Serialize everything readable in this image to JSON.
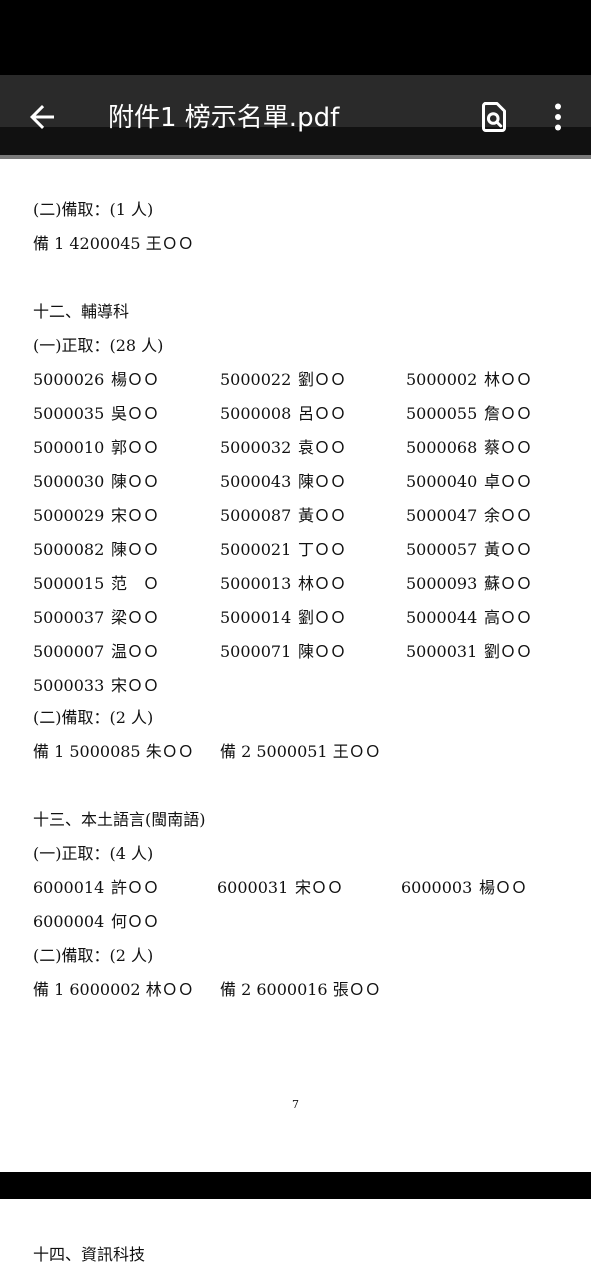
{
  "app_bar": {
    "title": "附件1 榜示名單.pdf",
    "icons": [
      "arrow-back-icon",
      "search-in-document-icon",
      "more-vert-icon"
    ]
  },
  "sec11": {
    "backup_heading": "(二)備取：(1 人)",
    "backup_line": "備 1 4200045 王ＯＯ"
  },
  "sec12": {
    "heading": "十二、輔導科",
    "admit_heading": "(一)正取：(28 人)",
    "rows": [
      [
        {
          "id": "5000026",
          "name": "楊ＯＯ"
        },
        {
          "id": "5000022",
          "name": "劉ＯＯ"
        },
        {
          "id": "5000002",
          "name": "林ＯＯ"
        }
      ],
      [
        {
          "id": "5000035",
          "name": "吳ＯＯ"
        },
        {
          "id": "5000008",
          "name": "呂ＯＯ"
        },
        {
          "id": "5000055",
          "name": "詹ＯＯ"
        }
      ],
      [
        {
          "id": "5000010",
          "name": "郭ＯＯ"
        },
        {
          "id": "5000032",
          "name": "袁ＯＯ"
        },
        {
          "id": "5000068",
          "name": "蔡ＯＯ"
        }
      ],
      [
        {
          "id": "5000030",
          "name": "陳ＯＯ"
        },
        {
          "id": "5000043",
          "name": "陳ＯＯ"
        },
        {
          "id": "5000040",
          "name": "卓ＯＯ"
        }
      ],
      [
        {
          "id": "5000029",
          "name": "宋ＯＯ"
        },
        {
          "id": "5000087",
          "name": "黃ＯＯ"
        },
        {
          "id": "5000047",
          "name": "余ＯＯ"
        }
      ],
      [
        {
          "id": "5000082",
          "name": "陳ＯＯ"
        },
        {
          "id": "5000021",
          "name": "丁ＯＯ"
        },
        {
          "id": "5000057",
          "name": "黃ＯＯ"
        }
      ],
      [
        {
          "id": "5000015",
          "name": "范　Ｏ"
        },
        {
          "id": "5000013",
          "name": "林ＯＯ"
        },
        {
          "id": "5000093",
          "name": "蘇ＯＯ"
        }
      ],
      [
        {
          "id": "5000037",
          "name": "梁ＯＯ"
        },
        {
          "id": "5000014",
          "name": "劉ＯＯ"
        },
        {
          "id": "5000044",
          "name": "高ＯＯ"
        }
      ],
      [
        {
          "id": "5000007",
          "name": "温ＯＯ"
        },
        {
          "id": "5000071",
          "name": "陳ＯＯ"
        },
        {
          "id": "5000031",
          "name": "劉ＯＯ"
        }
      ],
      [
        {
          "id": "5000033",
          "name": "宋ＯＯ"
        }
      ]
    ],
    "backup_heading": "(二)備取：(2 人)",
    "backup_lines": [
      "備 1 5000085 朱ＯＯ",
      "備 2 5000051 王ＯＯ"
    ]
  },
  "sec13": {
    "heading": "十三、本土語言(閩南語)",
    "admit_heading": "(一)正取：(4 人)",
    "rows": [
      [
        {
          "id": "6000014",
          "name": "許ＯＯ"
        },
        {
          "id": "6000031",
          "name": "宋ＯＯ"
        },
        {
          "id": "6000003",
          "name": "楊ＯＯ"
        }
      ],
      [
        {
          "id": "6000004",
          "name": "何ＯＯ"
        }
      ]
    ],
    "backup_heading": "(二)備取：(2 人)",
    "backup_lines": [
      "備 1 6000002 林ＯＯ",
      "備 2 6000016 張ＯＯ"
    ]
  },
  "page_number": "7",
  "next_page": {
    "heading": "十四、資訊科技"
  }
}
